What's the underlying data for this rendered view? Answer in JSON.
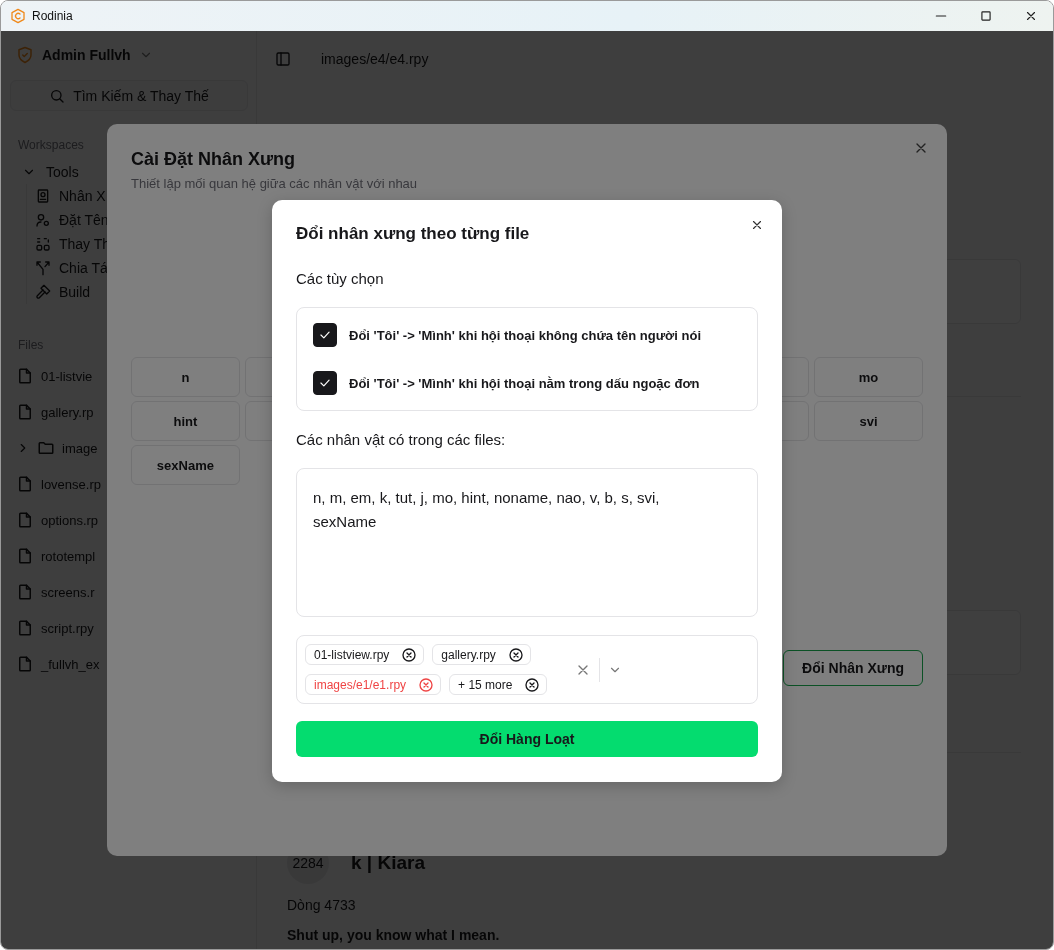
{
  "window": {
    "title": "Rodinia"
  },
  "sidebar": {
    "user": "Admin Fullvh",
    "search_button": "Tìm Kiếm & Thay Thế",
    "workspaces_heading": "Workspaces",
    "tools": {
      "label": "Tools",
      "expanded": true,
      "children": [
        {
          "label": "Nhân X"
        },
        {
          "label": "Đặt Tên"
        },
        {
          "label": "Thay Th"
        },
        {
          "label": "Chia Tá"
        },
        {
          "label": "Build"
        }
      ]
    },
    "files_heading": "Files",
    "files": [
      {
        "name": "01-listvie",
        "kind": "file"
      },
      {
        "name": "gallery.rp",
        "kind": "file"
      },
      {
        "name": "image",
        "kind": "folder",
        "expanded": false
      },
      {
        "name": "lovense.rp",
        "kind": "file"
      },
      {
        "name": "options.rp",
        "kind": "file"
      },
      {
        "name": "rototempl",
        "kind": "file"
      },
      {
        "name": "screens.r",
        "kind": "file"
      },
      {
        "name": "script.rpy",
        "kind": "file"
      },
      {
        "name": "_fullvh_ex",
        "kind": "file"
      }
    ]
  },
  "editor": {
    "path": "images/e4/e4.rpy",
    "entry": {
      "avatar": "2284",
      "speaker": "k | Kiara",
      "line": "Dòng 4733",
      "text": "Shut up, you know what I mean."
    }
  },
  "pronoun_dialog": {
    "title": "Cài Đặt Nhân Xưng",
    "subtitle": "Thiết lập mối quan hệ giữa các nhân vật với nhau",
    "characters": [
      {
        "kind": "visible",
        "label": "n"
      },
      {
        "kind": "covered"
      },
      {
        "kind": "hidden"
      },
      {
        "kind": "hidden"
      },
      {
        "kind": "hidden"
      },
      {
        "kind": "covered"
      },
      {
        "kind": "visible",
        "label": "mo"
      },
      {
        "kind": "visible",
        "label": "hint"
      },
      {
        "kind": "covered"
      },
      {
        "kind": "hidden"
      },
      {
        "kind": "hidden"
      },
      {
        "kind": "hidden"
      },
      {
        "kind": "covered"
      },
      {
        "kind": "visible",
        "label": "svi"
      },
      {
        "kind": "visible",
        "label": "sexName"
      }
    ],
    "apply_button": "Đổi Nhân Xưng"
  },
  "batch_dialog": {
    "title": "Đổi nhân xưng theo từng file",
    "options_heading": "Các tùy chọn",
    "options": [
      {
        "label": "Đổi 'Tôi' -> 'Mình' khi hội thoại không chứa tên người nói",
        "checked": true
      },
      {
        "label": "Đổi 'Tôi' -> 'Mình' khi hội thoại nằm trong dấu ngoặc đơn",
        "checked": true
      }
    ],
    "characters_heading": "Các nhân vật có trong các files:",
    "characters_text": "n, m, em, k, tut, j, mo, hint, noname, nao, v, b, s, svi, sexName",
    "files": [
      {
        "label": "01-listview.rpy",
        "invalid": false
      },
      {
        "label": "gallery.rpy",
        "invalid": false
      },
      {
        "label": "images/e1/e1.rpy",
        "invalid": true
      },
      {
        "label": "+ 15 more",
        "invalid": false
      }
    ],
    "submit_button": "Đổi Hàng Loạt"
  }
}
